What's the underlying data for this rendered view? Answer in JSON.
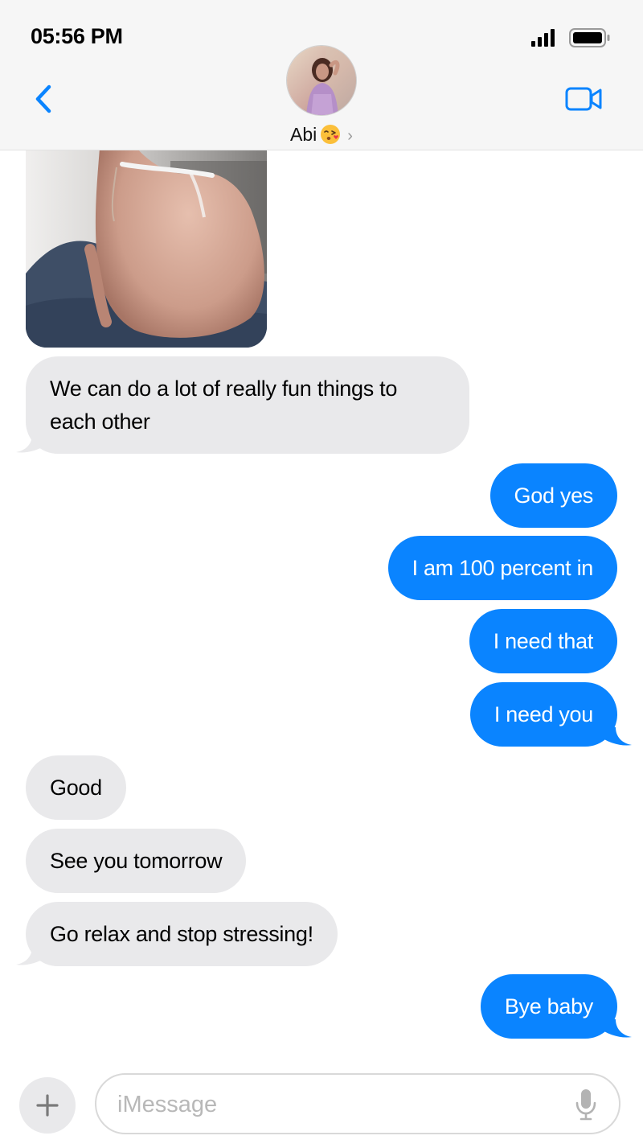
{
  "status_bar": {
    "time": "05:56 PM"
  },
  "contact": {
    "name": "Abi",
    "emoji_icon": "kissing-face-emoji",
    "chevron": "›"
  },
  "messages": [
    {
      "direction": "incoming",
      "type": "image",
      "icon": "photo-attachment"
    },
    {
      "direction": "incoming",
      "text": "We can do a lot of really fun things to each other"
    },
    {
      "direction": "outgoing",
      "text": "God yes"
    },
    {
      "direction": "outgoing",
      "text": "I am 100 percent in"
    },
    {
      "direction": "outgoing",
      "text": "I need that"
    },
    {
      "direction": "outgoing",
      "text": "I need you"
    },
    {
      "direction": "incoming",
      "text": "Good"
    },
    {
      "direction": "incoming",
      "text": "See you tomorrow"
    },
    {
      "direction": "incoming",
      "text": "Go relax and stop stressing!"
    },
    {
      "direction": "outgoing",
      "text": "Bye baby"
    }
  ],
  "composer": {
    "placeholder": "iMessage",
    "value": ""
  },
  "colors": {
    "accent": "#0a84ff",
    "incoming_bubble": "#e9e9eb",
    "header_bg": "#f6f6f6"
  }
}
